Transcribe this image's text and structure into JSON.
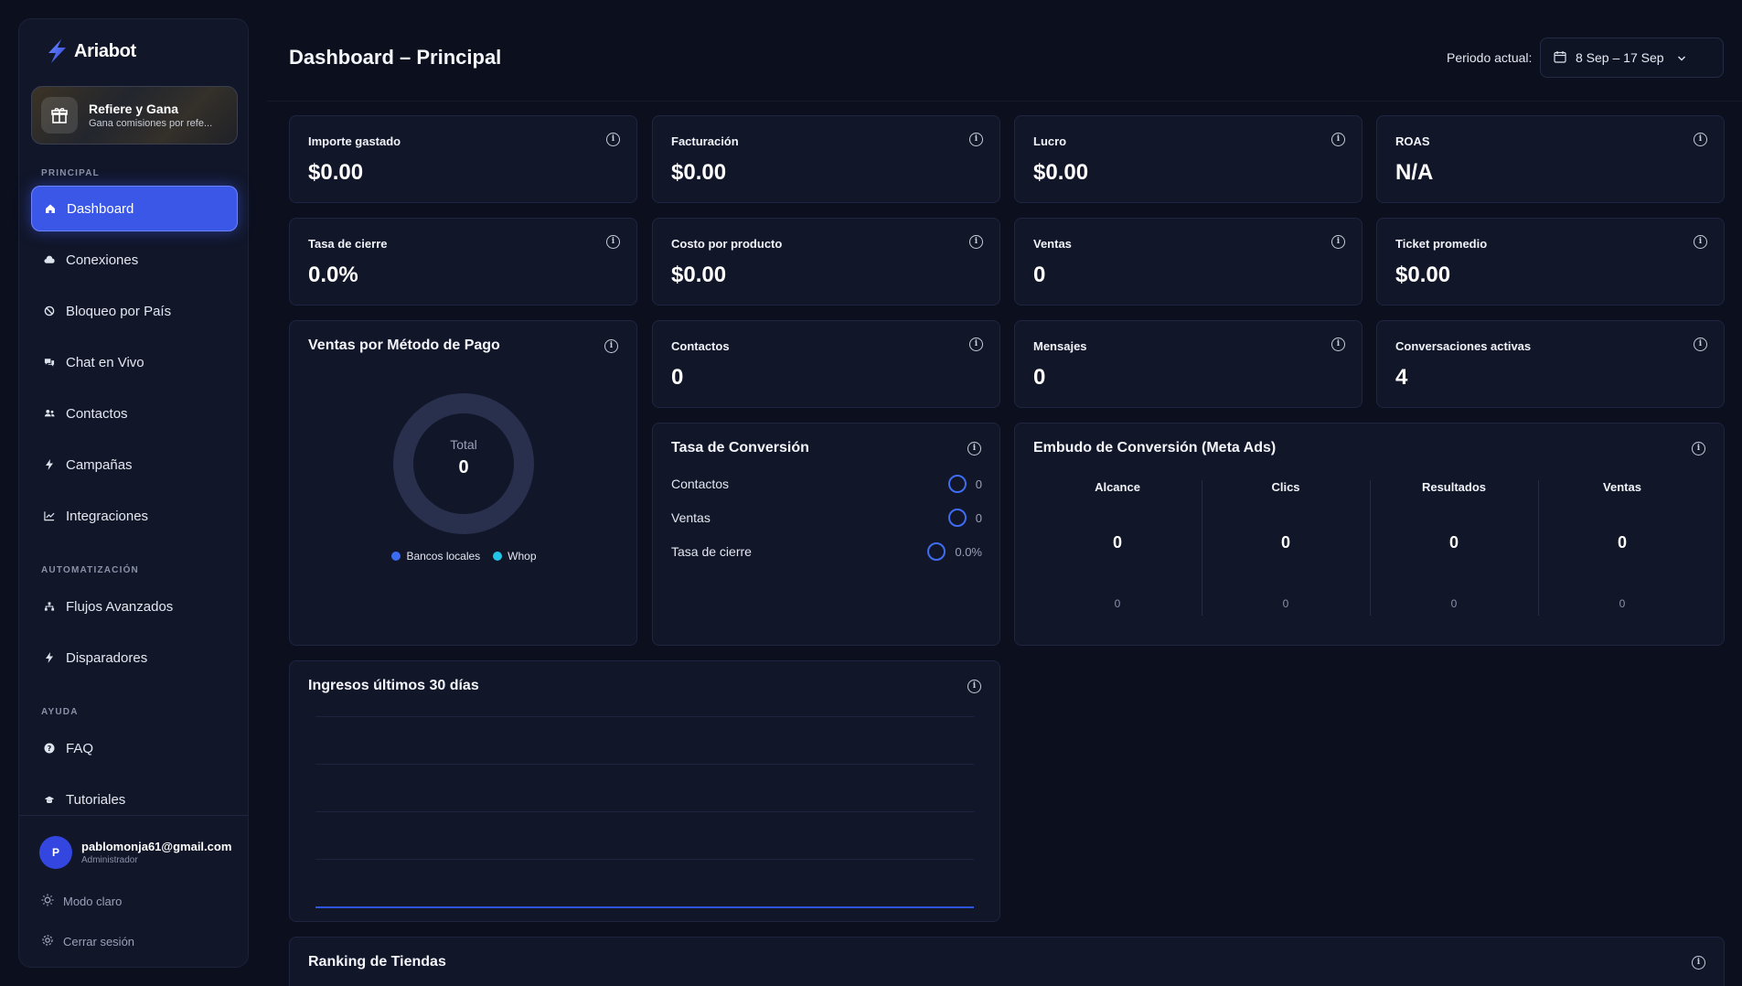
{
  "brand": {
    "name": "Ariabot"
  },
  "promo": {
    "title": "Refiere y Gana",
    "subtitle": "Gana comisiones por refe..."
  },
  "sections": {
    "principal": "PRINCIPAL",
    "automatizacion": "AUTOMATIZACIÓN",
    "ayuda": "AYUDA"
  },
  "nav": [
    {
      "label": "Dashboard",
      "icon": "home-icon"
    },
    {
      "label": "Conexiones",
      "icon": "cloud-icon"
    },
    {
      "label": "Bloqueo por País",
      "icon": "block-icon"
    },
    {
      "label": "Chat en Vivo",
      "icon": "chat-icon"
    },
    {
      "label": "Contactos",
      "icon": "users-icon"
    },
    {
      "label": "Campañas",
      "icon": "bolt-icon"
    },
    {
      "label": "Integraciones",
      "icon": "chart-line-icon"
    },
    {
      "label": "Flujos Avanzados",
      "icon": "flow-icon"
    },
    {
      "label": "Disparadores",
      "icon": "bolt-icon"
    },
    {
      "label": "FAQ",
      "icon": "help-icon"
    },
    {
      "label": "Tutoriales",
      "icon": "graduation-cap-icon"
    }
  ],
  "user": {
    "initial": "P",
    "email": "pablomonja61@gmail.com",
    "role": "Administrador"
  },
  "footer_links": {
    "theme": "Modo claro",
    "logout": "Cerrar sesión"
  },
  "header": {
    "title": "Dashboard – Principal",
    "period_label": "Periodo actual:",
    "period_value": "8 Sep – 17 Sep"
  },
  "kpis": [
    {
      "label": "Importe gastado",
      "value": "$0.00"
    },
    {
      "label": "Facturación",
      "value": "$0.00"
    },
    {
      "label": "Lucro",
      "value": "$0.00"
    },
    {
      "label": "ROAS",
      "value": "N/A"
    },
    {
      "label": "Tasa de cierre",
      "value": "0.0%"
    },
    {
      "label": "Costo por producto",
      "value": "$0.00"
    },
    {
      "label": "Ventas",
      "value": "0"
    },
    {
      "label": "Ticket promedio",
      "value": "$0.00"
    },
    {
      "label": "Contactos",
      "value": "0"
    },
    {
      "label": "Mensajes",
      "value": "0"
    },
    {
      "label": "Conversaciones activas",
      "value": "4"
    }
  ],
  "payment_methods": {
    "title": "Ventas por Método de Pago",
    "total_label": "Total",
    "total_value": "0",
    "legend": [
      {
        "name": "Bancos locales",
        "color": "#3b6cf0"
      },
      {
        "name": "Whop",
        "color": "#22c4e8"
      }
    ]
  },
  "conversion_rate": {
    "title": "Tasa de Conversión",
    "rows": [
      {
        "label": "Contactos",
        "value": "0"
      },
      {
        "label": "Ventas",
        "value": "0"
      },
      {
        "label": "Tasa de cierre",
        "value": "0.0%"
      }
    ]
  },
  "funnel": {
    "title": "Embudo de Conversión (Meta Ads)",
    "columns": [
      {
        "label": "Alcance",
        "value": "0",
        "sub": "0"
      },
      {
        "label": "Clics",
        "value": "0",
        "sub": "0"
      },
      {
        "label": "Resultados",
        "value": "0",
        "sub": "0"
      },
      {
        "label": "Ventas",
        "value": "0",
        "sub": "0"
      }
    ]
  },
  "revenue": {
    "title": "Ingresos últimos 30 días"
  },
  "ranking": {
    "title": "Ranking de Tiendas"
  },
  "colors": {
    "accent": "#3b57e8",
    "background": "#0b0f1e",
    "card": "#111629",
    "border": "#1f2540"
  }
}
